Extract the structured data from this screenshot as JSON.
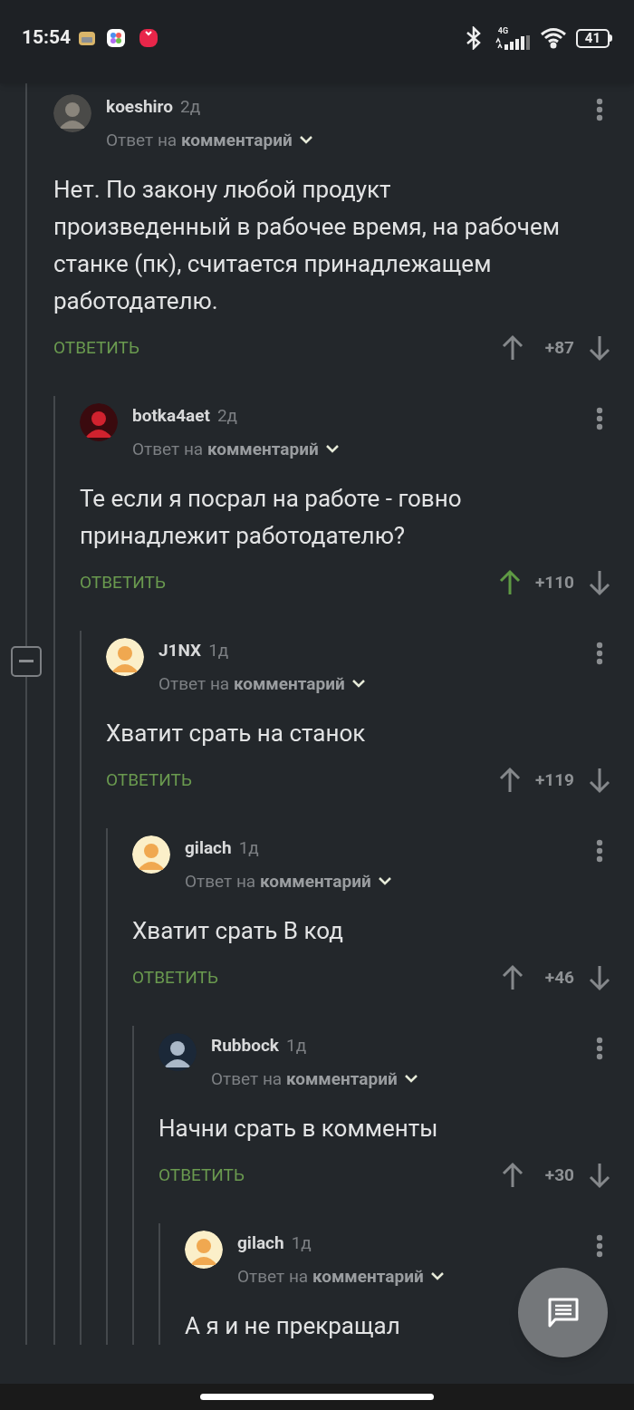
{
  "status_bar": {
    "time": "15:54",
    "network": "4G",
    "battery": "41"
  },
  "comments": [
    {
      "author": "koeshiro",
      "age": "2д",
      "reply_prefix": "Ответ на",
      "reply_target": "комментарий",
      "body": "Нет. По закону любой продукт произведенный в рабочее время, на рабочем станке (пк), считается принадлежащем работодателю.",
      "reply_label": "ОТВЕТИТЬ",
      "score": "+87",
      "upvoted": false,
      "children": [
        {
          "author": "botka4aet",
          "age": "2д",
          "reply_prefix": "Ответ на",
          "reply_target": "комментарий",
          "body": "Те если я посрал на работе - говно принадлежит работодателю?",
          "reply_label": "ОТВЕТИТЬ",
          "score": "+110",
          "upvoted": true,
          "children": [
            {
              "author": "J1NX",
              "age": "1д",
              "reply_prefix": "Ответ на",
              "reply_target": "комментарий",
              "body": "Хватит срать на станок",
              "reply_label": "ОТВЕТИТЬ",
              "score": "+119",
              "upvoted": false,
              "collapsible": true,
              "children": [
                {
                  "author": "gilach",
                  "age": "1д",
                  "reply_prefix": "Ответ на",
                  "reply_target": "комментарий",
                  "body": "Хватит срать В код",
                  "reply_label": "ОТВЕТИТЬ",
                  "score": "+46",
                  "upvoted": false,
                  "children": [
                    {
                      "author": "Rubbock",
                      "age": "1д",
                      "reply_prefix": "Ответ на",
                      "reply_target": "комментарий",
                      "body": "Начни срать в комменты",
                      "reply_label": "ОТВЕТИТЬ",
                      "score": "+30",
                      "upvoted": false,
                      "children": [
                        {
                          "author": "gilach",
                          "age": "1д",
                          "reply_prefix": "Ответ на",
                          "reply_target": "комментарий",
                          "body": "А я и не прекращал"
                        }
                      ]
                    }
                  ]
                }
              ]
            }
          ]
        }
      ]
    }
  ]
}
